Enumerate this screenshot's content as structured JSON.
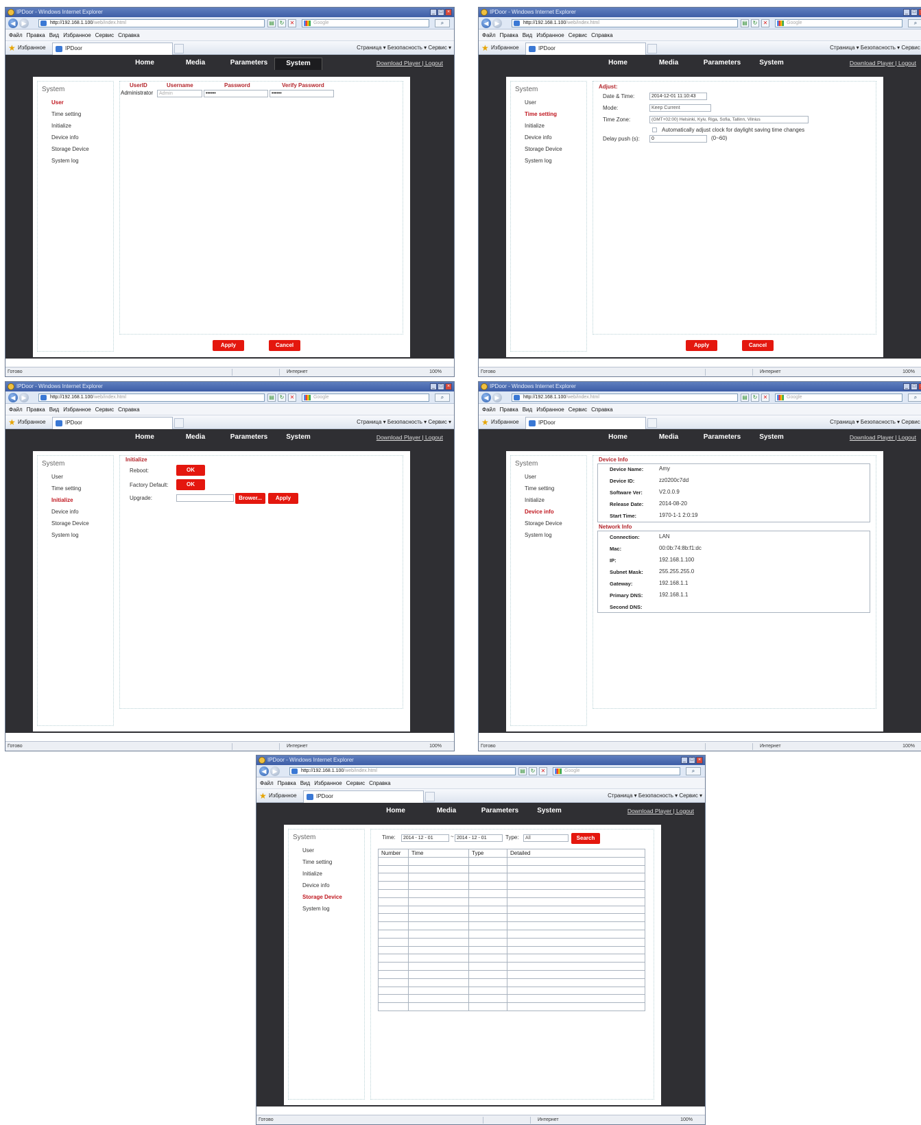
{
  "browser": {
    "title": "IPDoor - Windows Internet Explorer",
    "url_host": "http://192.168.1.100",
    "url_path": "/web/index.html",
    "search_placeholder": "Google",
    "menu": [
      "Файл",
      "Правка",
      "Вид",
      "Избранное",
      "Сервис",
      "Справка"
    ],
    "favorites_label": "Избранное",
    "tab_label": "IPDoor",
    "command_bar": "Страница ▾  Безопасность ▾  Сервис ▾",
    "status_ready": "Готово",
    "status_zone": "Интернет",
    "status_zoom": "100%"
  },
  "nav": {
    "home": "Home",
    "media": "Media",
    "parameters": "Parameters",
    "system": "System",
    "download": "Download Player | Logout"
  },
  "sidebar": {
    "title": "System",
    "items": [
      "User",
      "Time setting",
      "Initialize",
      "Device info",
      "Storage Device",
      "System log"
    ]
  },
  "buttons": {
    "apply": "Apply",
    "cancel": "Cancel",
    "ok": "OK",
    "browse": "Brower...",
    "search": "Search"
  },
  "user_page": {
    "headers": [
      "UserID",
      "Username",
      "Password",
      "Verify Password"
    ],
    "userid": "Administrator",
    "username_placeholder": "Admin",
    "password": "••••••",
    "verify": "••••••"
  },
  "time_page": {
    "section": "Adjust:",
    "date_label": "Date & Time:",
    "date_value": "2014-12-01 11:10:43",
    "mode_label": "Mode:",
    "mode_value": "Keep Current",
    "tz_label": "Time Zone:",
    "tz_value": "(GMT+02:00) Helsinki, Kyiv, Riga, Sofia, Tallinn, Vilnius",
    "dst_label": "Automatically adjust clock for daylight saving time changes",
    "delay_label": "Delay push (s):",
    "delay_value": "0",
    "delay_range": "(0~60)"
  },
  "init_page": {
    "section": "Initialize",
    "reboot": "Reboot:",
    "factory": "Factory Default:",
    "upgrade": "Upgrade:"
  },
  "device_page": {
    "device_section": "Device Info",
    "device_rows": [
      {
        "k": "Device Name:",
        "v": "Amy"
      },
      {
        "k": "Device ID:",
        "v": "zz0200c7dd"
      },
      {
        "k": "Software Ver:",
        "v": "V2.0.0.9"
      },
      {
        "k": "Release Date:",
        "v": "2014-08-20"
      },
      {
        "k": "Start Time:",
        "v": "1970-1-1 2:0:19"
      }
    ],
    "network_section": "Network Info",
    "network_rows": [
      {
        "k": "Connection:",
        "v": "LAN"
      },
      {
        "k": "Mac:",
        "v": "00:0b:74:8b:f1:dc"
      },
      {
        "k": "IP:",
        "v": "192.168.1.100"
      },
      {
        "k": "Subnet Mask:",
        "v": "255.255.255.0"
      },
      {
        "k": "Gateway:",
        "v": "192.168.1.1"
      },
      {
        "k": "Primary DNS:",
        "v": "192.168.1.1"
      },
      {
        "k": "Second DNS:",
        "v": ""
      }
    ]
  },
  "log_page": {
    "time_label": "Time:",
    "from": "2014 - 12 - 01",
    "tilde": "~",
    "to": "2014 - 12 - 01",
    "type_label": "Type:",
    "type_value": "All",
    "columns": [
      "Number",
      "Time",
      "Type",
      "Detailed"
    ]
  }
}
